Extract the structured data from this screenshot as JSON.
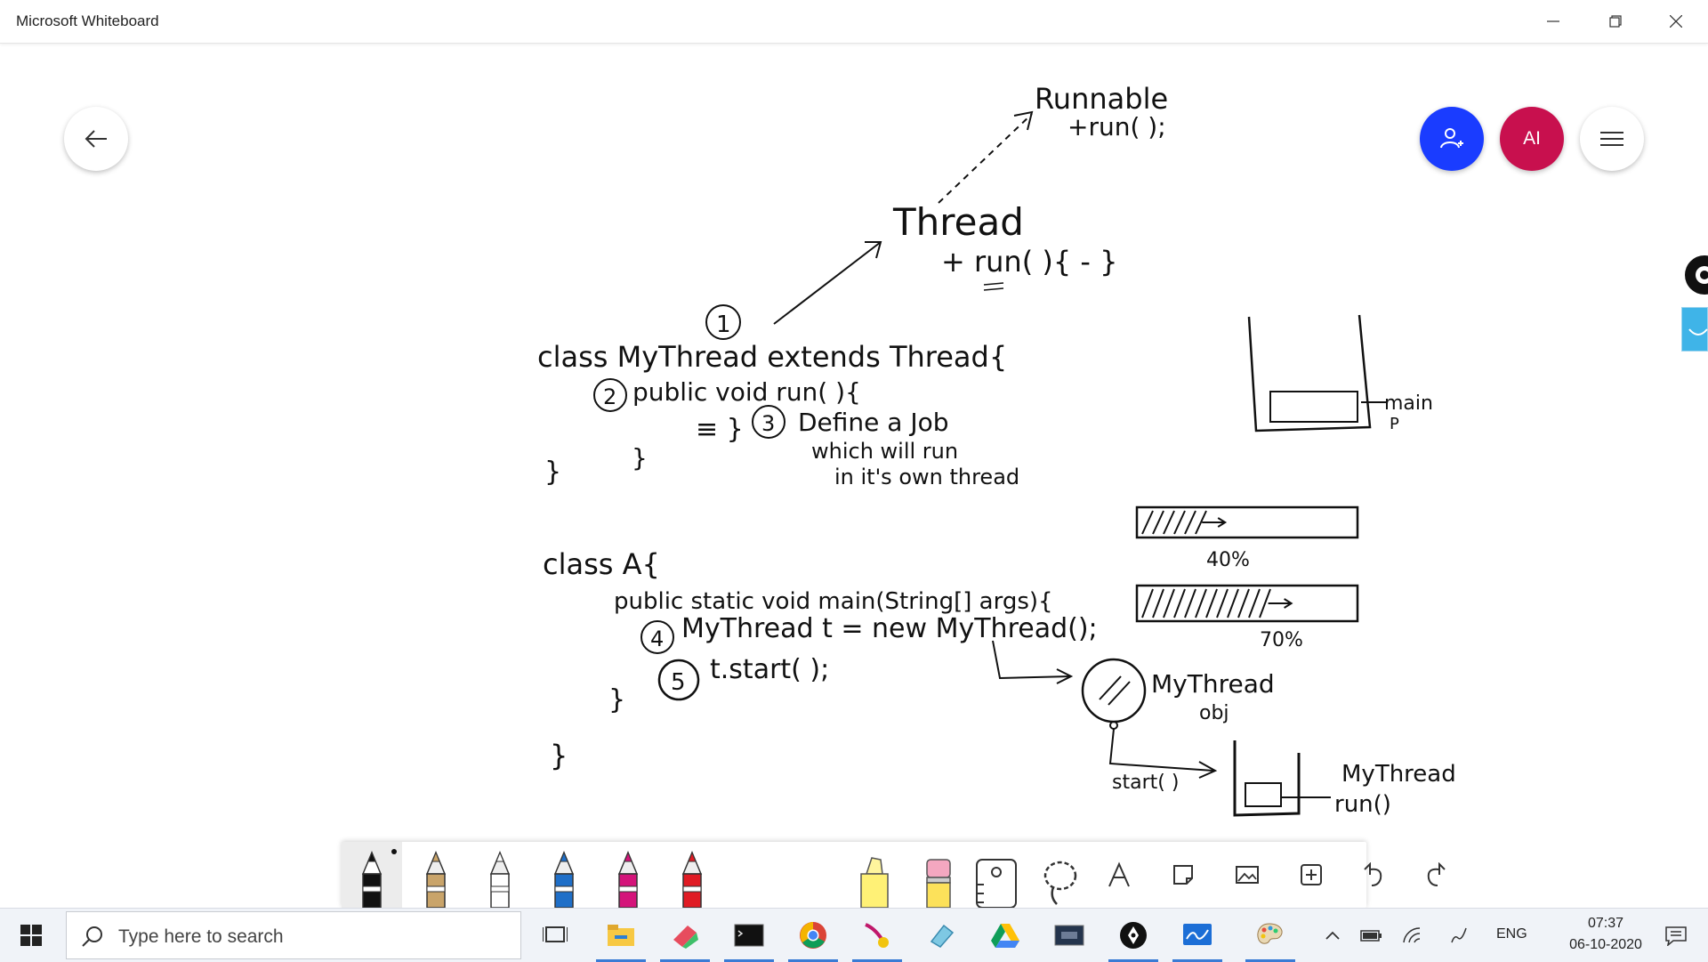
{
  "window": {
    "title": "Microsoft Whiteboard"
  },
  "header": {
    "avatar_initials": "AI"
  },
  "ink": {
    "runnable_name": "Runnable",
    "runnable_method": "+run( );",
    "thread_name": "Thread",
    "thread_method": "+ run( ){ - }",
    "step1": "1",
    "line1": "class  MyThread  extends  Thread{",
    "step2": "2",
    "line2": "public  void  run( ){",
    "line3_prefix": "≡ }",
    "step3": "3",
    "line3": "Define a Job",
    "line4": "which will run",
    "line5": "in it's own thread",
    "brace_a": "}",
    "brace_b": "}",
    "classA": "class  A{",
    "main_line": "public static void main(String[] args){",
    "step4": "4",
    "line_new": "MyThread  t = new  MyThread();",
    "step5": "5",
    "line_start": "t.start( );",
    "brace_c": "}",
    "brace_d": "}",
    "stack_label": "main",
    "stack_label_sub": "P",
    "progress1_pct": "40%",
    "progress1_value": 0.4,
    "progress2_pct": "70%",
    "progress2_value": 0.7,
    "obj_label1": "MyThread",
    "obj_label2": "obj",
    "start_label": "start( )",
    "stack2_label1": "MyThread",
    "stack2_label2": "run()"
  },
  "toolbar": {
    "tools": [
      {
        "name": "black-pen",
        "color": "#111111"
      },
      {
        "name": "gold-pen",
        "color": "#c9a46a"
      },
      {
        "name": "white-pen",
        "color": "#ffffff"
      },
      {
        "name": "blue-pen",
        "color": "#1f6fc8"
      },
      {
        "name": "magenta-pen",
        "color": "#d4147a"
      },
      {
        "name": "red-pen",
        "color": "#e01b24"
      },
      {
        "name": "highlighter",
        "color": "#fff176"
      },
      {
        "name": "eraser",
        "color": "#f4a7c0"
      }
    ]
  },
  "taskbar": {
    "search_placeholder": "Type here to search",
    "language": "ENG",
    "time": "07:37",
    "date": "06-10-2020"
  },
  "colors": {
    "accent_blue": "#1a3cff",
    "avatar_red": "#c8104e",
    "taskbar_bg": "#f0f3f8"
  }
}
